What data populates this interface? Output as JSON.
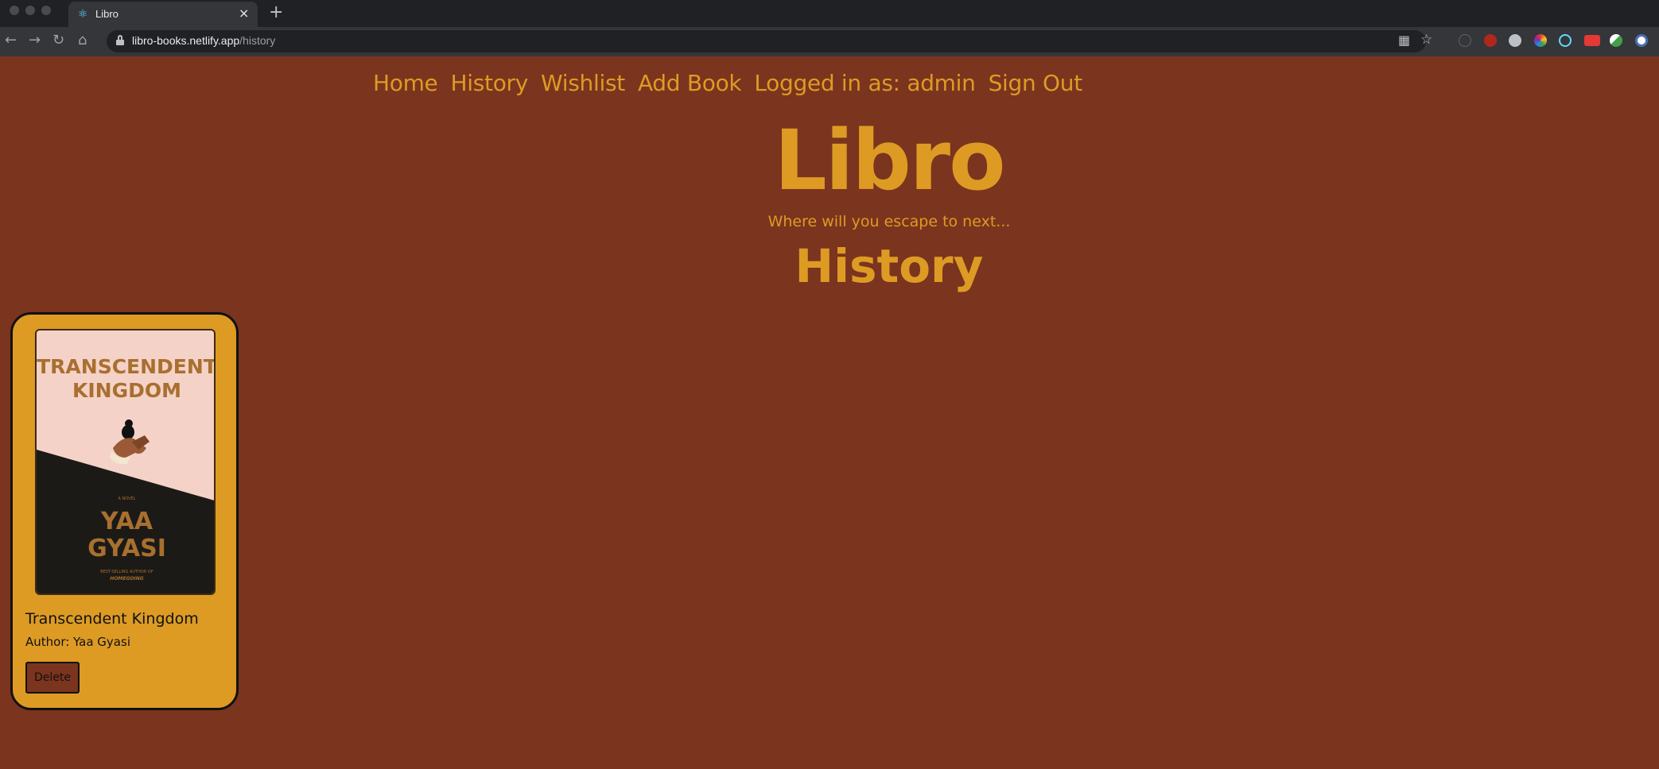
{
  "browser": {
    "tab_title": "Libro",
    "url_host": "libro-books.netlify.app",
    "url_path": "/history"
  },
  "nav": {
    "items": [
      "Home",
      "History",
      "Wishlist",
      "Add Book",
      "Logged in as: admin",
      "Sign Out"
    ]
  },
  "header": {
    "brand": "Libro",
    "tagline": "Where will you escape to next...",
    "page_title": "History"
  },
  "books": [
    {
      "title": "Transcendent Kingdom",
      "author_line": "Author: Yaa Gyasi",
      "delete_label": "Delete",
      "cover": {
        "title_line1": "TRANSCENDENT",
        "title_line2": "KINGDOM",
        "kicker": "A NOVEL",
        "author_line1": "YAA",
        "author_line2": "GYASI",
        "blurb_line1": "BEST-SELLING AUTHOR OF",
        "blurb_line2": "HOMEGOING"
      }
    }
  ],
  "colors": {
    "page_background": "#7b341e",
    "accent": "#dd9b24",
    "card_background": "#dd9b24"
  }
}
